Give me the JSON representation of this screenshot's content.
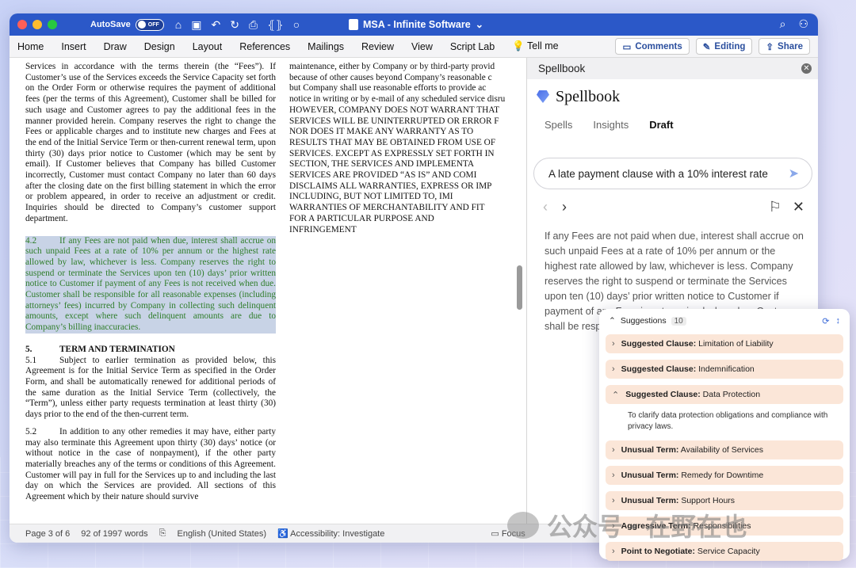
{
  "titlebar": {
    "autosave_label": "AutoSave",
    "autosave_state": "OFF",
    "doc_title": "MSA - Infinite Software",
    "doc_chevron": "⌄"
  },
  "ribbon": {
    "tabs": [
      "Home",
      "Insert",
      "Draw",
      "Design",
      "Layout",
      "References",
      "Mailings",
      "Review",
      "View",
      "Script Lab",
      "Tell me"
    ],
    "comments_label": "Comments",
    "editing_label": "Editing",
    "share_label": "Share"
  },
  "document": {
    "col1_intro": "Services in accordance with the terms therein (the “Fees”). If Customer’s use of the Services exceeds the Service Capacity set forth on the Order Form or otherwise requires the payment of additional fees (per the terms of this Agreement), Customer shall be billed for such usage and Customer agrees to pay the additional fees in the manner provided herein. Company reserves the right to change the Fees or applicable charges and to institute new charges and Fees at the end of the Initial Service Term or then-current renewal term, upon thirty (30) days prior notice to Customer (which may be sent by email). If Customer believes that Company has billed Customer incorrectly, Customer must contact Company no later than 60 days after the closing date on the first billing statement in which the error or problem appeared, in order to receive an adjustment or credit. Inquiries should be directed to Company’s customer support department.",
    "highlight_num": "4.2",
    "highlight_text": "If any Fees are not paid when due, interest shall accrue on such unpaid Fees at a rate of 10% per annum or the highest rate allowed by law, whichever is less. Company reserves the right to suspend or terminate the Services upon ten (10) days’ prior written notice to Customer if payment of any Fees is not received when due. Customer shall be responsible for all reasonable expenses (including attorneys’ fees) incurred by Company in collecting such delinquent amounts, except where such delinquent amounts are due to Company’s billing inaccuracies.",
    "section_num": "5.",
    "section_title": "TERM AND TERMINATION",
    "p51_num": "5.1",
    "p51_text": "Subject to earlier termination as provided below, this Agreement is for the Initial Service Term as specified in the Order Form, and shall be automatically renewed for additional periods of the same duration as the Initial Service Term (collectively, the “Term”), unless either party requests termination at least thirty (30) days prior to the end of the then-current term.",
    "p52_num": "5.2",
    "p52_text": "In addition to any other remedies it may have, either party may also terminate this Agreement upon thirty (30) days’ notice (or without notice in the case of nonpayment), if the other party materially breaches any of the terms or conditions of this Agreement. Customer will pay in full for the Services up to and including the last day on which the Services are provided. All sections of this Agreement which by their nature should survive",
    "col2_lines": [
      "maintenance, either by Company or by third-party provid",
      "because of other causes beyond Company’s reasonable c",
      "but Company shall use reasonable efforts to provide ac",
      "notice in writing or by e-mail of any scheduled service disru",
      "HOWEVER, COMPANY DOES NOT WARRANT THAT",
      "SERVICES WILL BE UNINTERRUPTED OR ERROR F",
      "NOR DOES IT MAKE ANY WARRANTY AS TO",
      "RESULTS THAT MAY BE OBTAINED FROM USE OF",
      "SERVICES.  EXCEPT AS EXPRESSLY SET FORTH IN",
      "SECTION,   THE   SERVICES   AND   IMPLEMENTA",
      "SERVICES ARE PROVIDED “AS IS” AND COMI",
      "DISCLAIMS ALL WARRANTIES, EXPRESS OR IMP",
      "INCLUDING,   BUT   NOT   LIMITED   TO,   IMI",
      "WARRANTIES OF MERCHANTABILITY AND FIT",
      "FOR    A    PARTICULAR    PURPOSE    AND",
      "INFRINGEMENT"
    ]
  },
  "panel": {
    "header": "Spellbook",
    "brand": "Spellbook",
    "tabs": [
      "Spells",
      "Insights",
      "Draft"
    ],
    "prompt": "A late payment clause with a 10% interest rate",
    "draft_text": "If any Fees are not paid when due, interest shall accrue on such unpaid Fees at a rate of 10% per annum or the highest rate allowed by law, whichever is less. Company reserves the right to suspend or terminate the Services upon ten (10) days’ prior written notice to Customer if payment of any Fees is not received when due. Customer shall be resp attorneys’ fe delinquent a amounts are"
  },
  "suggestions": {
    "title": "Suggestions",
    "count": "10",
    "items": [
      {
        "type": "Suggested Clause:",
        "label": "Limitation of Liability"
      },
      {
        "type": "Suggested Clause:",
        "label": "Indemnification"
      },
      {
        "type": "Suggested Clause:",
        "label": "Data Protection"
      },
      {
        "type": "Unusual Term:",
        "label": "Availability of Services"
      },
      {
        "type": "Unusual Term:",
        "label": "Remedy for Downtime"
      },
      {
        "type": "Unusual Term:",
        "label": "Support Hours"
      },
      {
        "type": "Aggressive Term:",
        "label": "Responsibilities"
      },
      {
        "type": "Point to Negotiate:",
        "label": "Service Capacity"
      }
    ],
    "expanded_desc": "To clarify data protection obligations and compliance with privacy laws."
  },
  "status": {
    "page": "Page 3 of 6",
    "words": "92 of 1997 words",
    "language": "English (United States)",
    "accessibility": "Accessibility: Investigate",
    "focus": "Focus"
  },
  "watermark": {
    "text": "公众号 · 在野在也"
  }
}
